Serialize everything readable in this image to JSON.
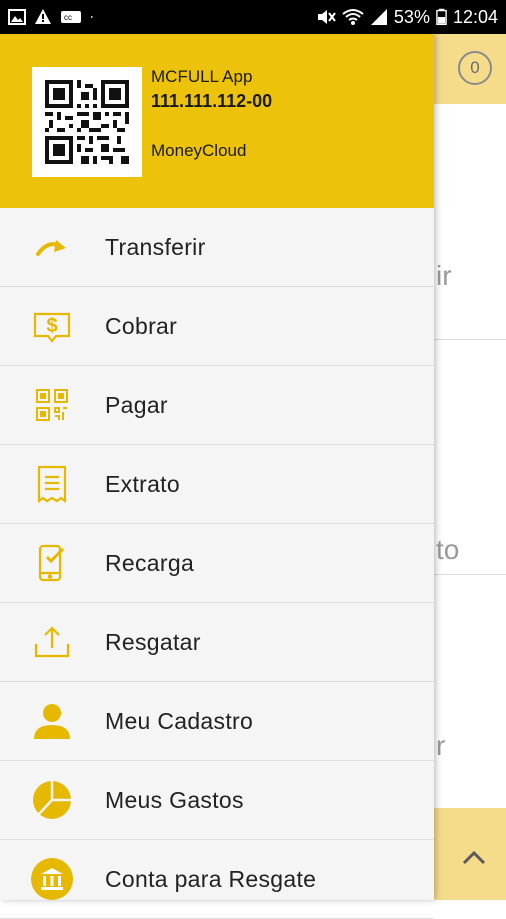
{
  "status_bar": {
    "battery": "53%",
    "time": "12:04"
  },
  "header": {
    "app_name": "MCFULL App",
    "account_number": "111.111.112-00",
    "company": "MoneyCloud"
  },
  "background": {
    "badge_count": "0",
    "partial_texts": [
      "ir",
      "to",
      "r"
    ]
  },
  "menu": {
    "items": [
      {
        "label": "Transferir",
        "icon": "transfer-arrow-icon"
      },
      {
        "label": "Cobrar",
        "icon": "dollar-bill-icon"
      },
      {
        "label": "Pagar",
        "icon": "qr-code-icon"
      },
      {
        "label": "Extrato",
        "icon": "receipt-icon"
      },
      {
        "label": "Recarga",
        "icon": "phone-recharge-icon"
      },
      {
        "label": "Resgatar",
        "icon": "upload-tray-icon"
      },
      {
        "label": "Meu Cadastro",
        "icon": "person-icon"
      },
      {
        "label": "Meus Gastos",
        "icon": "pie-chart-icon"
      },
      {
        "label": "Conta para Resgate",
        "icon": "bank-icon"
      }
    ]
  },
  "colors": {
    "accent": "#ecc30a",
    "accent_light": "#f5dc8a",
    "icon_yellow": "#e6b800"
  }
}
